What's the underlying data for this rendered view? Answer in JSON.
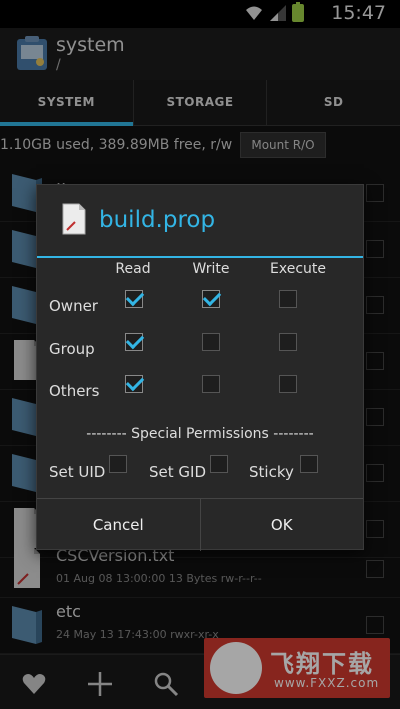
{
  "status_bar": {
    "time": "15:47",
    "icons": [
      "wifi-icon",
      "signal-icon",
      "battery-icon"
    ]
  },
  "action_bar": {
    "title": "system",
    "path": "/"
  },
  "tabs": [
    {
      "label": "SYSTEM",
      "active": true
    },
    {
      "label": "STORAGE",
      "active": false
    },
    {
      "label": "SD",
      "active": false
    }
  ],
  "storage": {
    "info": "1.10GB used, 389.89MB free, r/w",
    "mount_button": "Mount R/O"
  },
  "files": [
    {
      "name": "..",
      "meta": "",
      "type": "folder"
    },
    {
      "name": "",
      "meta": "",
      "type": "folder"
    },
    {
      "name": "",
      "meta": "",
      "type": "folder"
    },
    {
      "name": "",
      "meta": "",
      "type": "file"
    },
    {
      "name": "",
      "meta": "",
      "type": "folder"
    },
    {
      "name": "",
      "meta": "",
      "type": "folder"
    },
    {
      "name": "",
      "meta": "",
      "type": "file"
    },
    {
      "name": "CSCVersion.txt",
      "meta": "01 Aug 08 13:00:00  13 Bytes  rw-r--r--",
      "type": "file"
    },
    {
      "name": "etc",
      "meta": "24 May 13 17:43:00  rwxr-xr-x",
      "type": "folder"
    }
  ],
  "dialog": {
    "title": "build.prop",
    "columns": [
      "Read",
      "Write",
      "Execute"
    ],
    "rows": [
      {
        "label": "Owner",
        "read": true,
        "write": true,
        "execute": false
      },
      {
        "label": "Group",
        "read": true,
        "write": false,
        "execute": false
      },
      {
        "label": "Others",
        "read": true,
        "write": false,
        "execute": false
      }
    ],
    "special_heading": "-------- Special Permissions --------",
    "special": [
      {
        "label": "Set UID",
        "checked": false
      },
      {
        "label": "Set GID",
        "checked": false
      },
      {
        "label": "Sticky",
        "checked": false
      }
    ],
    "cancel_label": "Cancel",
    "ok_label": "OK"
  },
  "bottom_bar": {
    "icons": [
      "heart-icon",
      "plus-icon",
      "search-icon"
    ]
  },
  "watermark": {
    "text": "飞翔下载",
    "url": "www.FXXZ.com"
  },
  "colors": {
    "accent": "#33b5e5",
    "background": "#111111",
    "dialog": "#282828",
    "watermark": "#d03a2f"
  }
}
